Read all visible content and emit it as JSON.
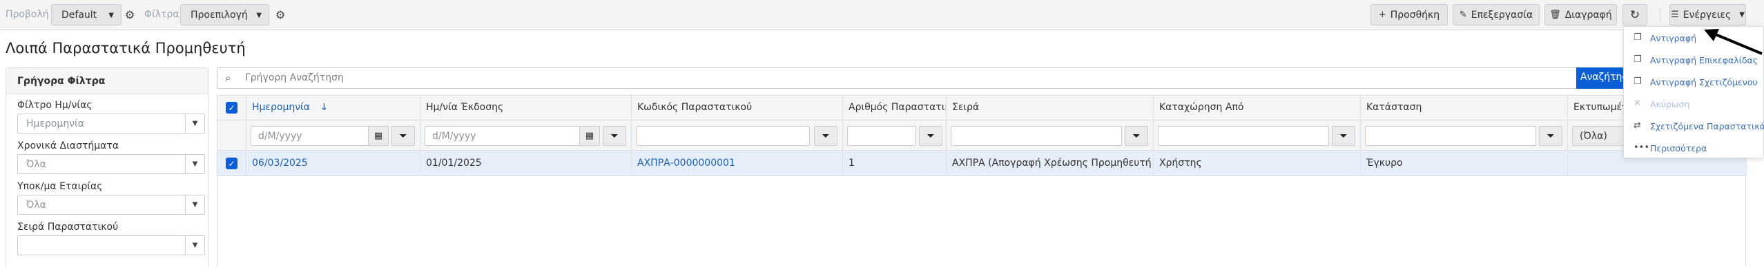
{
  "toolbar": {
    "view_label": "Προβολή",
    "view_value": "Default",
    "filters_label": "Φίλτρα",
    "filters_value": "Προεπιλογή",
    "add_label": "Προσθήκη",
    "edit_label": "Επεξεργασία",
    "delete_label": "Διαγραφή",
    "actions_label": "Ενέργειες",
    "icons": {
      "gear": "gear-icon",
      "add": "plus-icon",
      "edit": "pencil-icon",
      "delete": "trash-icon",
      "refresh": "refresh-icon",
      "actions": "menu-icon",
      "caret": "chevron-down-icon"
    }
  },
  "page": {
    "title": "Λοιπά Παραστατικά Προμηθευτή"
  },
  "quick_filters": {
    "title": "Γρήγορα Φίλτρα",
    "fields": [
      {
        "label": "Φίλτρο Ημ/νίας",
        "value": "Ημερομηνία"
      },
      {
        "label": "Χρονικά Διαστήματα",
        "value": "Όλα"
      },
      {
        "label": "Υποκ/μα Εταιρίας",
        "value": "Όλα"
      },
      {
        "label": "Σειρά Παραστατικού",
        "value": ""
      }
    ]
  },
  "search": {
    "placeholder": "Γρήγορη Αναζήτηση",
    "button_label": "Αναζήτηση"
  },
  "grid": {
    "columns": [
      "Ημερομηνία",
      "Ημ/νία Έκδοσης",
      "Κωδικός Παραστατικού",
      "Αριθμός Παραστατικού",
      "Σειρά",
      "Καταχώρηση Από",
      "Κατάσταση",
      "Εκτυπωμένο"
    ],
    "sort_indicator": "↓",
    "filter_placeholders": {
      "date": "d/M/yyyy",
      "issue_date": "d/M/yyyy",
      "printed": "(Όλα)"
    },
    "rows": [
      {
        "date": "06/03/2025",
        "issue_date": "01/01/2025",
        "code": "ΑΧΠΡΑ-0000000001",
        "number": "1",
        "series": "ΑΧΠΡΑ (Απογραφή Χρέωσης Προμηθευτή ...",
        "entered_by": "Χρήστης",
        "status": "Έγκυρο",
        "printed": ""
      }
    ]
  },
  "actions_menu": {
    "items": [
      {
        "label": "Αντιγραφή",
        "icon": "copy-icon",
        "enabled": true
      },
      {
        "label": "Αντιγραφή Επικεφαλίδας",
        "icon": "copy-icon",
        "enabled": true
      },
      {
        "label": "Αντιγραφή Σχετιζόμενου",
        "icon": "copy-icon",
        "enabled": true
      },
      {
        "label": "Ακύρωση",
        "icon": "close-icon",
        "enabled": false
      },
      {
        "label": "Σχετιζόμενα Παραστατικά",
        "icon": "exchange-icon",
        "enabled": true
      },
      {
        "label": "Περισσότερα",
        "icon": "ellipsis-icon",
        "enabled": true
      }
    ]
  },
  "colors": {
    "accent": "#0b5ed7",
    "link": "#1a5fb4",
    "selected_row": "#e6eef9",
    "toolbar_bg": "#f4f4f4"
  }
}
